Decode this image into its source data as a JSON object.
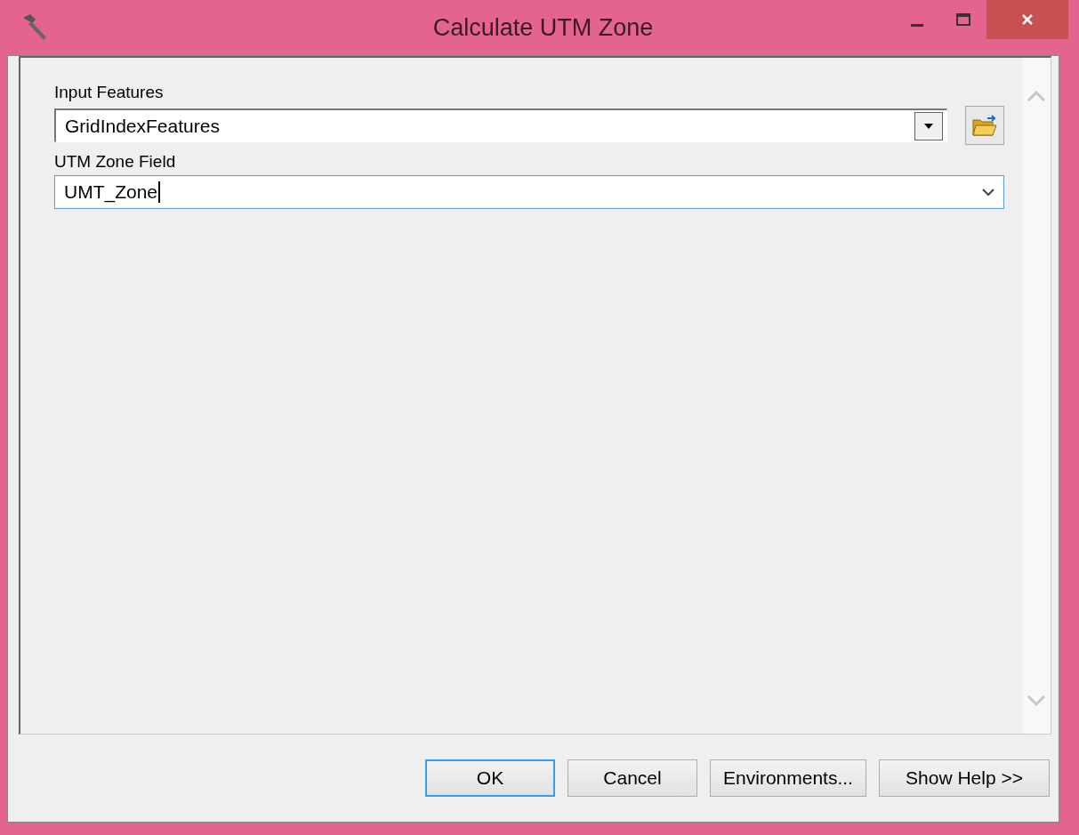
{
  "window": {
    "title": "Calculate UTM Zone"
  },
  "parameters": [
    {
      "label": "Input Features",
      "value": "GridIndexFeatures",
      "kind": "combo",
      "focused": false
    },
    {
      "label": "UTM Zone Field",
      "value": "UMT_Zone",
      "kind": "select",
      "focused": true
    }
  ],
  "buttons": [
    {
      "label": "OK",
      "default": true
    },
    {
      "label": "Cancel",
      "default": false
    },
    {
      "label": "Environments...",
      "default": false
    },
    {
      "label": "Show Help >>",
      "default": false
    }
  ]
}
